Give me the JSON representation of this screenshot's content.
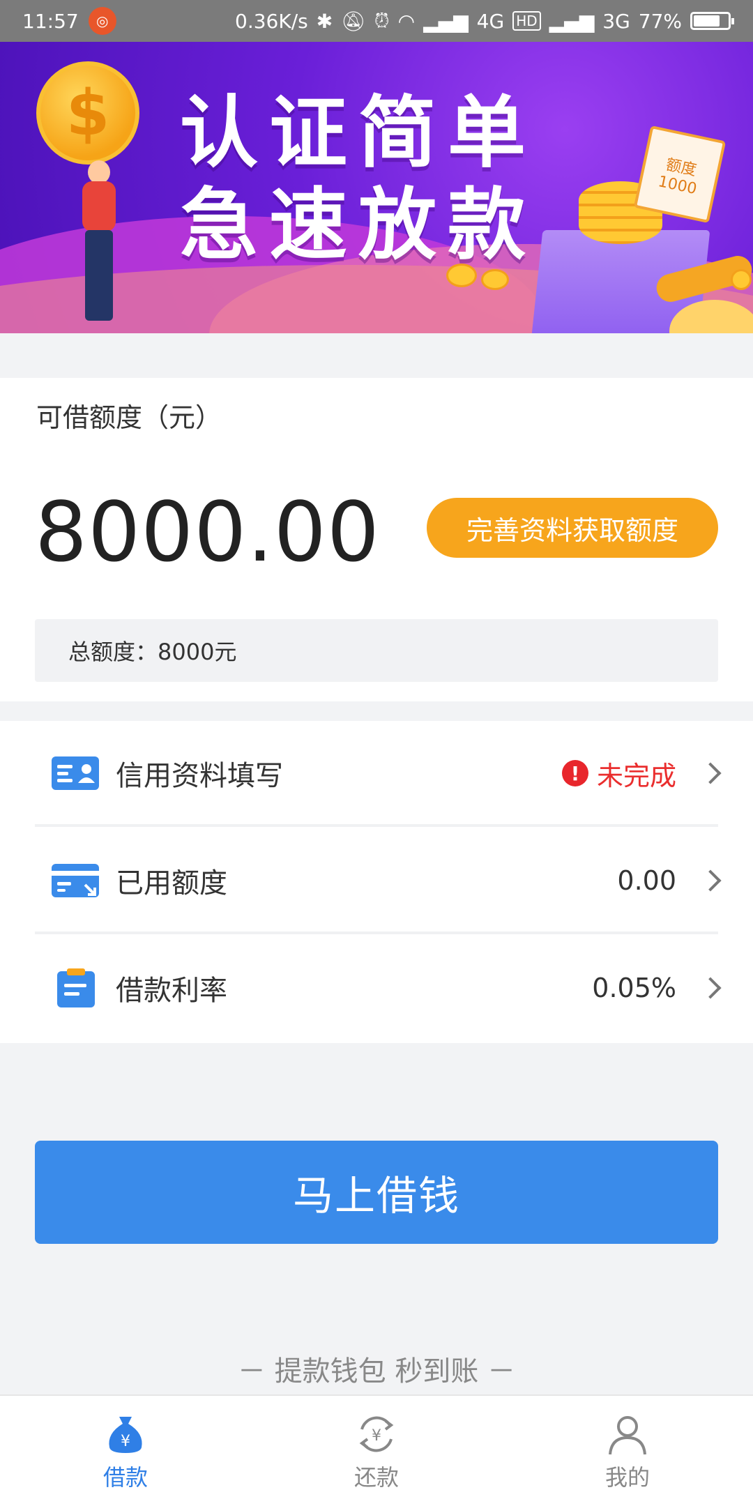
{
  "status_bar": {
    "time": "11:57",
    "network_speed": "0.36K/s",
    "network_4g": "4G",
    "hd_badge": "HD",
    "network_3g": "3G",
    "battery": "77%",
    "battery_level": 0.77
  },
  "banner": {
    "line1": "认证简单",
    "line2": "急速放款",
    "ticket_label": "额度",
    "ticket_amount": "1000",
    "coin_symbol": "$"
  },
  "credit": {
    "title": "可借额度（元）",
    "amount": "8000.00",
    "complete_button": "完善资料获取额度",
    "total_label": "总额度：8000元"
  },
  "rows": [
    {
      "label": "信用资料填写",
      "value": "未完成",
      "icon": "id-card-icon"
    },
    {
      "label": "已用额度",
      "value": "0.00",
      "icon": "credit-card-icon"
    },
    {
      "label": "借款利率",
      "value": "0.05%",
      "icon": "clipboard-icon"
    }
  ],
  "warning_symbol": "!",
  "primary_button": "马上借钱",
  "slogan": "－ 提款钱包 秒到账 －",
  "nav": {
    "items": [
      {
        "label": "借款",
        "active": true
      },
      {
        "label": "还款",
        "active": false
      },
      {
        "label": "我的",
        "active": false
      }
    ]
  },
  "colors": {
    "accent_blue": "#3a8bea",
    "orange": "#f7a51c",
    "warning_red": "#ea2e2e"
  }
}
